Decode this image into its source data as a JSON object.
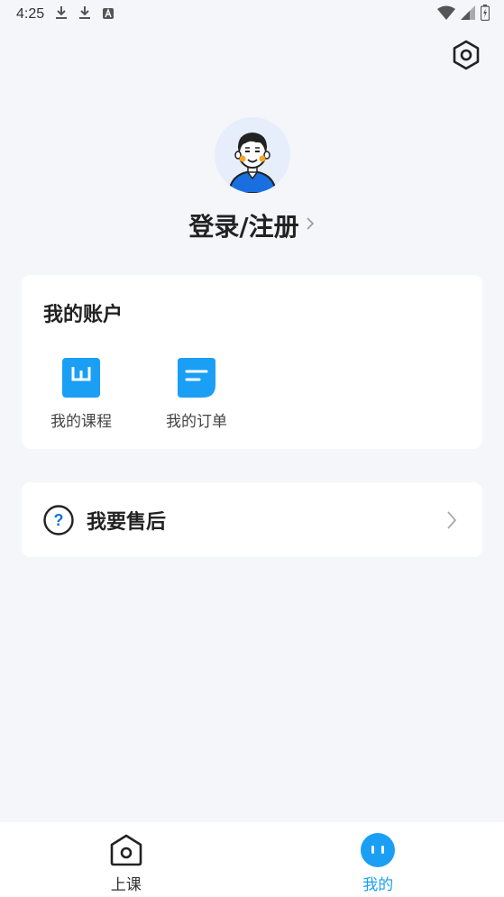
{
  "status_bar": {
    "time": "4:25",
    "left_icons": [
      "download-icon",
      "download-icon",
      "keyboard-icon"
    ],
    "right_icons": [
      "wifi-icon",
      "signal-icon",
      "battery-icon"
    ]
  },
  "header": {
    "settings_icon": "settings-icon"
  },
  "profile": {
    "avatar_icon": "user-avatar",
    "login_label": "登录/注册"
  },
  "account": {
    "title": "我的账户",
    "items": [
      {
        "label": "我的课程",
        "icon": "course-icon"
      },
      {
        "label": "我的订单",
        "icon": "order-icon"
      }
    ]
  },
  "service": {
    "label": "我要售后",
    "icon": "question-icon"
  },
  "tab_bar": {
    "tabs": [
      {
        "label": "上课",
        "icon": "class-icon",
        "active": false
      },
      {
        "label": "我的",
        "icon": "mine-icon",
        "active": true
      }
    ]
  },
  "colors": {
    "accent": "#1a9ff5",
    "background": "#f5f6fa",
    "card": "#ffffff"
  }
}
